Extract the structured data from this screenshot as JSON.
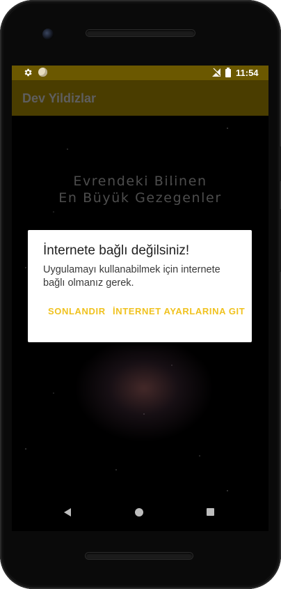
{
  "status_bar": {
    "time": "11:54",
    "icons": [
      "gear-icon",
      "sync-icon",
      "signal-icon",
      "battery-icon"
    ]
  },
  "app_bar": {
    "title": "Dev Yildizlar"
  },
  "background": {
    "headline_line1": "Evrendeki Bilinen",
    "headline_line2": "En Büyük Gezegenler"
  },
  "dialog": {
    "title": "İnternete bağlı değilsiniz!",
    "message": "Uygulamayı kullanabilmek için internete bağlı olmanız gerek.",
    "button_end": "SONLANDIR",
    "button_settings": "İNTERNET AYARLARINA GIT"
  },
  "nav_bar": {
    "icons": [
      "back-icon",
      "home-icon",
      "recents-icon"
    ]
  },
  "colors": {
    "status_bar": "#6b5800",
    "app_bar": "#4a3d00",
    "dialog_button": "#f0c21f"
  }
}
